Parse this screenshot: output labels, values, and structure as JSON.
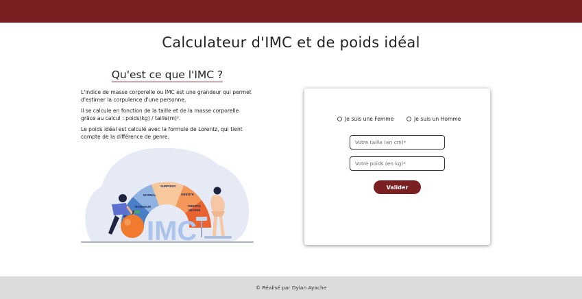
{
  "header": {
    "color": "#7a1f22"
  },
  "title": "Calculateur d'IMC et de poids idéal",
  "info": {
    "heading": "Qu'est ce que l'IMC ?",
    "paragraphs": [
      "L'indice de masse corporelle ou IMC est une grandeur qui permet d'estimer la corpulence d'une personne.",
      "Il se calcule en fonction de la taille et de la masse corporelle grâce au calcul : poids(kg) / taille(m)².",
      "Le poids idéal est calculé avec la formule de Lorentz, qui tient compte de la différence de genre."
    ]
  },
  "illustration": {
    "big_label": "IMC",
    "gauge_labels": {
      "underweight": "MAIGREUR",
      "normal": "NORMAL",
      "overweight": "SURPOIDS",
      "obese": "OBESITE",
      "obese_severe_1": "OBESITE",
      "obese_severe_2": "SEVERE"
    }
  },
  "form": {
    "female_label": "Je suis une Femme",
    "male_label": "Je suis un Homme",
    "height_placeholder": "Votre taille (en cm)*",
    "weight_placeholder": "Votre poids (en kg)*",
    "submit_label": "Valider"
  },
  "footer": {
    "text": "© Réalisé par Dylan Ayache"
  }
}
